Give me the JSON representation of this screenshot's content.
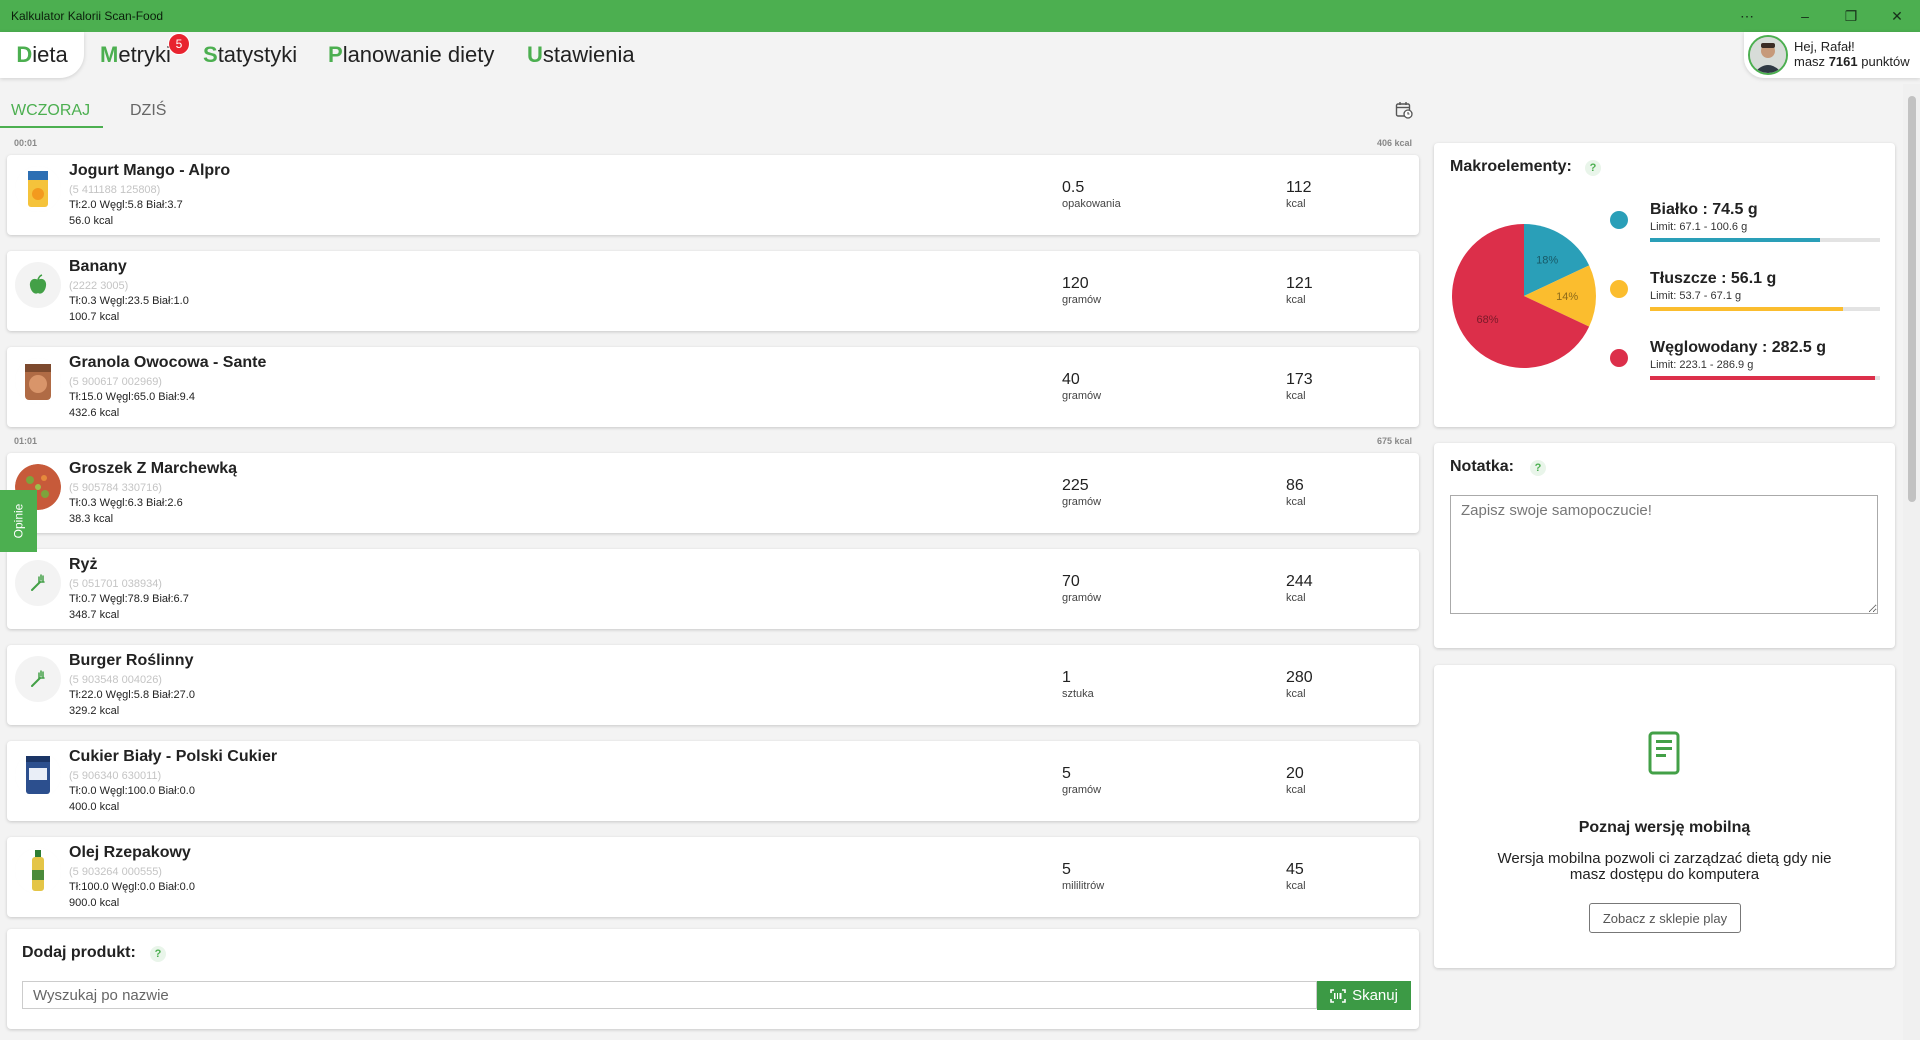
{
  "window": {
    "title": "Kalkulator Kalorii Scan-Food",
    "more": "⋯",
    "minimize": "–",
    "restore": "❐",
    "close": "✕"
  },
  "nav": {
    "tabs": [
      {
        "first": "D",
        "rest": "ieta"
      },
      {
        "first": "M",
        "rest": "etryki"
      },
      {
        "first": "S",
        "rest": "tatystyki"
      },
      {
        "first": "P",
        "rest": "lanowanie diety"
      },
      {
        "first": "U",
        "rest": "stawienia"
      }
    ],
    "metrics_badge": "5"
  },
  "user": {
    "greeting": "Hej, Rafał!",
    "points_prefix": "masz",
    "points": "7161",
    "points_suffix": "punktów"
  },
  "days": {
    "yesterday": "WCZORAJ",
    "today": "DZIŚ"
  },
  "groups": [
    {
      "time": "00:01",
      "kcal": "406 kcal"
    },
    {
      "time": "01:01",
      "kcal": "675 kcal"
    }
  ],
  "items": [
    {
      "name": "Jogurt Mango - Alpro",
      "code": "(5 411188 125808)",
      "macros": "Tł:2.0 Węgl:5.8 Biał:3.7",
      "kcal100": "56.0 kcal",
      "qty": "0.5",
      "unit": "opakowania",
      "kcal": "112",
      "kunit": "kcal",
      "icon": "yogurt-product-icon"
    },
    {
      "name": "Banany",
      "code": "(2222 3005)",
      "macros": "Tł:0.3 Węgl:23.5 Biał:1.0",
      "kcal100": "100.7 kcal",
      "qty": "120",
      "unit": "gramów",
      "kcal": "121",
      "kunit": "kcal",
      "icon": "apple-icon"
    },
    {
      "name": "Granola Owocowa - Sante",
      "code": "(5 900617 002969)",
      "macros": "Tł:15.0 Węgl:65.0 Biał:9.4",
      "kcal100": "432.6 kcal",
      "qty": "40",
      "unit": "gramów",
      "kcal": "173",
      "kunit": "kcal",
      "icon": "granola-product-icon"
    },
    {
      "name": "Groszek Z Marchewką",
      "code": "(5 905784 330716)",
      "macros": "Tł:0.3 Węgl:6.3 Biał:2.6",
      "kcal100": "38.3 kcal",
      "qty": "225",
      "unit": "gramów",
      "kcal": "86",
      "kunit": "kcal",
      "icon": "peas-carrots-product-icon"
    },
    {
      "name": "Ryż",
      "code": "(5 051701 038934)",
      "macros": "Tł:0.7 Węgl:78.9 Biał:6.7",
      "kcal100": "348.7 kcal",
      "qty": "70",
      "unit": "gramów",
      "kcal": "244",
      "kunit": "kcal",
      "icon": "fork-icon"
    },
    {
      "name": "Burger Roślinny",
      "code": "(5 903548 004026)",
      "macros": "Tł:22.0 Węgl:5.8 Biał:27.0",
      "kcal100": "329.2 kcal",
      "qty": "1",
      "unit": "sztuka",
      "kcal": "280",
      "kunit": "kcal",
      "icon": "fork-icon"
    },
    {
      "name": "Cukier Biały - Polski Cukier",
      "code": "(5 906340 630011)",
      "macros": "Tł:0.0 Węgl:100.0 Biał:0.0",
      "kcal100": "400.0 kcal",
      "qty": "5",
      "unit": "gramów",
      "kcal": "20",
      "kunit": "kcal",
      "icon": "sugar-product-icon"
    },
    {
      "name": "Olej Rzepakowy",
      "code": "(5 903264 000555)",
      "macros": "Tł:100.0 Węgl:0.0 Biał:0.0",
      "kcal100": "900.0 kcal",
      "qty": "5",
      "unit": "mililitrów",
      "kcal": "45",
      "kunit": "kcal",
      "icon": "oil-bottle-product-icon"
    }
  ],
  "feedback_tab": "Opinie",
  "add_product": {
    "label": "Dodaj produkt:",
    "help": "?",
    "placeholder": "Wyszukaj po nazwie",
    "scan_label": "Skanuj"
  },
  "macros_panel": {
    "title": "Makroelementy:",
    "help": "?",
    "items": [
      {
        "name": "Białko : 74.5 g",
        "limit": "Limit: 67.1 - 100.6 g",
        "color": "#2a9fb8",
        "fill": 0.74
      },
      {
        "name": "Tłuszcze : 56.1 g",
        "limit": "Limit: 53.7 - 67.1 g",
        "color": "#fbbd2e",
        "fill": 0.84
      },
      {
        "name": "Węglowodany : 282.5 g",
        "limit": "Limit: 223.1 - 286.9 g",
        "color": "#dc2f4a",
        "fill": 0.98
      }
    ],
    "pie": [
      {
        "label": "18%",
        "value": 18,
        "color": "#2a9fb8"
      },
      {
        "label": "14%",
        "value": 14,
        "color": "#fbbd2e"
      },
      {
        "label": "68%",
        "value": 68,
        "color": "#dc2f4a"
      }
    ]
  },
  "note_panel": {
    "title": "Notatka:",
    "help": "?",
    "placeholder": "Zapisz swoje samopoczucie!"
  },
  "mobile_panel": {
    "title": "Poznaj wersję mobilną",
    "text": "Wersja mobilna pozwoli ci zarządzać dietą gdy nie masz dostępu do komputera",
    "button": "Zobacz z sklepie play"
  }
}
